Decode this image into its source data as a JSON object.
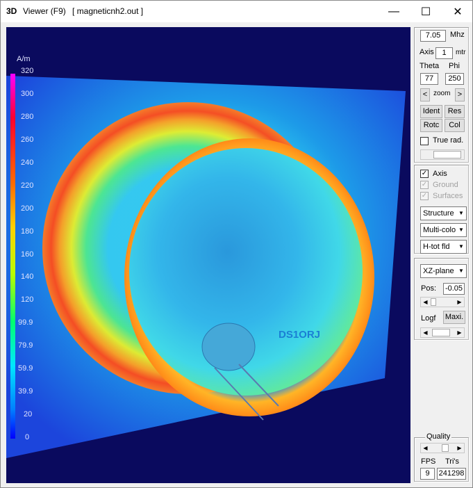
{
  "window": {
    "app_icon": "3D",
    "title": "Viewer (F9)",
    "file": "[  magneticnh2.out ]",
    "minimize_label": "—",
    "maximize_label": "☐",
    "close_label": "✕"
  },
  "colorbar": {
    "unit": "A/m",
    "ticks": [
      "320",
      "300",
      "280",
      "260",
      "240",
      "220",
      "200",
      "180",
      "160",
      "140",
      "120",
      "99.9",
      "79.9",
      "59.9",
      "39.9",
      "20",
      "0"
    ]
  },
  "viewport": {
    "callsign": "DS1ORJ",
    "callsign_color": "#1a7fd4",
    "background_color": "#0a0a5e"
  },
  "panel": {
    "freq_value": "7.05",
    "freq_unit": "Mhz",
    "axis_label": "Axis",
    "axis_value": "1",
    "axis_unit": "mtr",
    "theta_label": "Theta",
    "phi_label": "Phi",
    "theta_value": "77",
    "phi_value": "250",
    "zoom_left": "<",
    "zoom_label": "zoom",
    "zoom_right": ">",
    "ident_label": "Ident",
    "res_label": "Res",
    "rotc_label": "Rotc",
    "col_label": "Col",
    "true_rad_label": "True rad.",
    "axis_chk_label": "Axis",
    "ground_label": "Ground",
    "surfaces_label": "Surfaces",
    "structure_value": "Structure",
    "colors_value": "Multi-colo",
    "field_value": "H-tot fld",
    "plane_value": "XZ-plane",
    "pos_label": "Pos:",
    "pos_value": "-0.05",
    "logf_label": "Logf",
    "maxi_label": "Maxi.",
    "quality_label": "Quality",
    "fps_label": "FPS",
    "tris_label": "Tri's",
    "fps_value": "9",
    "tris_value": "241298"
  }
}
